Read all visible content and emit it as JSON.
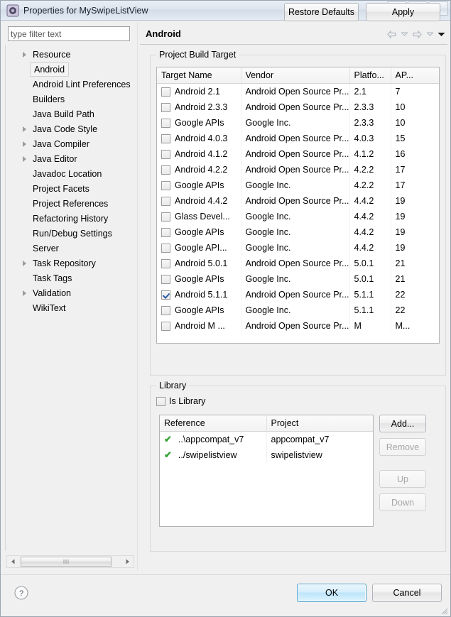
{
  "window": {
    "title": "Properties for MySwipeListView",
    "icon": "properties-icon",
    "minimize_label": "–",
    "maximize_label": "□",
    "close_label": "✕"
  },
  "sidebar": {
    "filter_placeholder": "type filter text",
    "filter_value": "",
    "items": [
      {
        "label": "Resource",
        "expandable": true,
        "selected": false
      },
      {
        "label": "Android",
        "expandable": false,
        "selected": true
      },
      {
        "label": "Android Lint Preferences",
        "expandable": false,
        "selected": false
      },
      {
        "label": "Builders",
        "expandable": false,
        "selected": false
      },
      {
        "label": "Java Build Path",
        "expandable": false,
        "selected": false
      },
      {
        "label": "Java Code Style",
        "expandable": true,
        "selected": false
      },
      {
        "label": "Java Compiler",
        "expandable": true,
        "selected": false
      },
      {
        "label": "Java Editor",
        "expandable": true,
        "selected": false
      },
      {
        "label": "Javadoc Location",
        "expandable": false,
        "selected": false
      },
      {
        "label": "Project Facets",
        "expandable": false,
        "selected": false
      },
      {
        "label": "Project References",
        "expandable": false,
        "selected": false
      },
      {
        "label": "Refactoring History",
        "expandable": false,
        "selected": false
      },
      {
        "label": "Run/Debug Settings",
        "expandable": false,
        "selected": false
      },
      {
        "label": "Server",
        "expandable": false,
        "selected": false
      },
      {
        "label": "Task Repository",
        "expandable": true,
        "selected": false
      },
      {
        "label": "Task Tags",
        "expandable": false,
        "selected": false
      },
      {
        "label": "Validation",
        "expandable": true,
        "selected": false
      },
      {
        "label": "WikiText",
        "expandable": false,
        "selected": false
      }
    ],
    "scrollbar_thumb_glyph": "…"
  },
  "page": {
    "title": "Android",
    "nav": {
      "back_icon": "arrow-left-icon",
      "back_caret_icon": "chevron-down-icon",
      "forward_icon": "arrow-right-icon",
      "forward_caret_icon": "chevron-down-icon",
      "menu_caret_icon": "chevron-down-icon"
    }
  },
  "build_target": {
    "group_label": "Project Build Target",
    "columns": [
      "Target Name",
      "Vendor",
      "Platfo...",
      "AP..."
    ],
    "rows": [
      {
        "checked": false,
        "name": "Android 2.1",
        "vendor": "Android Open Source Pr...",
        "platform": "2.1",
        "api": "7"
      },
      {
        "checked": false,
        "name": "Android 2.3.3",
        "vendor": "Android Open Source Pr...",
        "platform": "2.3.3",
        "api": "10"
      },
      {
        "checked": false,
        "name": "Google APIs",
        "vendor": "Google Inc.",
        "platform": "2.3.3",
        "api": "10"
      },
      {
        "checked": false,
        "name": "Android 4.0.3",
        "vendor": "Android Open Source Pr...",
        "platform": "4.0.3",
        "api": "15"
      },
      {
        "checked": false,
        "name": "Android 4.1.2",
        "vendor": "Android Open Source Pr...",
        "platform": "4.1.2",
        "api": "16"
      },
      {
        "checked": false,
        "name": "Android 4.2.2",
        "vendor": "Android Open Source Pr...",
        "platform": "4.2.2",
        "api": "17"
      },
      {
        "checked": false,
        "name": "Google APIs",
        "vendor": "Google Inc.",
        "platform": "4.2.2",
        "api": "17"
      },
      {
        "checked": false,
        "name": "Android 4.4.2",
        "vendor": "Android Open Source Pr...",
        "platform": "4.4.2",
        "api": "19"
      },
      {
        "checked": false,
        "name": "Glass Devel...",
        "vendor": "Google Inc.",
        "platform": "4.4.2",
        "api": "19"
      },
      {
        "checked": false,
        "name": "Google APIs",
        "vendor": "Google Inc.",
        "platform": "4.4.2",
        "api": "19"
      },
      {
        "checked": false,
        "name": "Google API...",
        "vendor": "Google Inc.",
        "platform": "4.4.2",
        "api": "19"
      },
      {
        "checked": false,
        "name": "Android 5.0.1",
        "vendor": "Android Open Source Pr...",
        "platform": "5.0.1",
        "api": "21"
      },
      {
        "checked": false,
        "name": "Google APIs",
        "vendor": "Google Inc.",
        "platform": "5.0.1",
        "api": "21"
      },
      {
        "checked": true,
        "name": "Android 5.1.1",
        "vendor": "Android Open Source Pr...",
        "platform": "5.1.1",
        "api": "22"
      },
      {
        "checked": false,
        "name": "Google APIs",
        "vendor": "Google Inc.",
        "platform": "5.1.1",
        "api": "22"
      },
      {
        "checked": false,
        "name": "Android M ...",
        "vendor": "Android Open Source Pr...",
        "platform": "M",
        "api": "M..."
      }
    ]
  },
  "library": {
    "group_label": "Library",
    "is_library_label": "Is Library",
    "is_library_checked": false,
    "columns": [
      "Reference",
      "Project"
    ],
    "rows": [
      {
        "status_icon": "check-green-icon",
        "reference": "..\\appcompat_v7",
        "project": "appcompat_v7"
      },
      {
        "status_icon": "check-green-icon",
        "reference": "../swipelistview",
        "project": "swipelistview"
      }
    ],
    "buttons": [
      {
        "label": "Add...",
        "enabled": true
      },
      {
        "label": "Remove",
        "enabled": false
      },
      {
        "label": "Up",
        "enabled": false
      },
      {
        "label": "Down",
        "enabled": false
      }
    ]
  },
  "footer": {
    "restore_defaults_label": "Restore Defaults",
    "apply_label": "Apply",
    "ok_label": "OK",
    "cancel_label": "Cancel",
    "help_icon": "help-icon",
    "help_glyph": "?"
  },
  "colors": {
    "accent": "#3c8dbc",
    "ok_border": "#4a9ec9",
    "check_green": "#32a332",
    "check_blue": "#2b5fa8",
    "dialog_bg": "#f0f0f0",
    "table_bg": "#ffffff"
  }
}
